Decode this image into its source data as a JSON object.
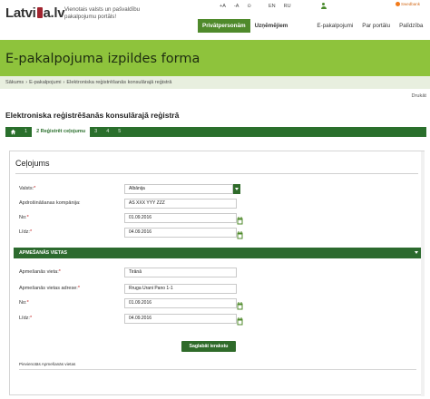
{
  "header": {
    "logo_text_a": "Latvi",
    "logo_text_b": "a.lv",
    "tagline": "Vienotais valsts un pašvaldību pakalpojumu portāls!",
    "tools": {
      "font_small": "+A",
      "font_big": "-A",
      "contrast": "⊙",
      "lang_en": "EN",
      "lang_ru": "RU"
    },
    "sponsor": "Swedbank",
    "nav": [
      "Privātpersonām",
      "Uzņēmējiem",
      "E-pakalpojumi",
      "Par portālu",
      "Palīdzība"
    ]
  },
  "banner": {
    "title": "E-pakalpojuma izpildes forma"
  },
  "breadcrumb": [
    "Sākums",
    "E-pakalpojumi",
    "Elektroniska reģistrēšanās konsulārajā reģistrā"
  ],
  "print_label": "Drukāt",
  "page_title": "Elektroniska reģistrēšanās konsulārajā reģistrā",
  "steps": [
    "1",
    "2",
    "Reģistrēt ceļojumu",
    "3",
    "4",
    "5"
  ],
  "form": {
    "title": "Ceļojums",
    "fields": [
      {
        "label": "Valsts:",
        "required": "*",
        "value": "Albānija"
      },
      {
        "label": "Apdrošināšanas kompānija:",
        "required": "",
        "value": "AS XXX YYY ZZZ"
      },
      {
        "label": "No:",
        "required": "*",
        "value": "01.09.2016"
      },
      {
        "label": "Līdz:",
        "required": "*",
        "value": "04.09.2016"
      }
    ],
    "section_title": "APMEŠANĀS VIETAS",
    "stay_fields": [
      {
        "label": "Apmešanās vieta:",
        "required": "*",
        "value": "Tirānā"
      },
      {
        "label": "Apmešanās vietas adrese:",
        "required": "*",
        "value": "Rruga Urani Pano 1-1"
      },
      {
        "label": "No:",
        "required": "*",
        "value": "01.09.2016"
      },
      {
        "label": "Līdz:",
        "required": "*",
        "value": "04.09.2016"
      }
    ],
    "save_label": "Saglabāt ierakstu",
    "footer_note": "Pievienotās Apmešanās vietas"
  },
  "colors": {
    "brand_green": "#8ec33c",
    "dark_green": "#2c6a2e",
    "accent_red": "#a1242f"
  }
}
